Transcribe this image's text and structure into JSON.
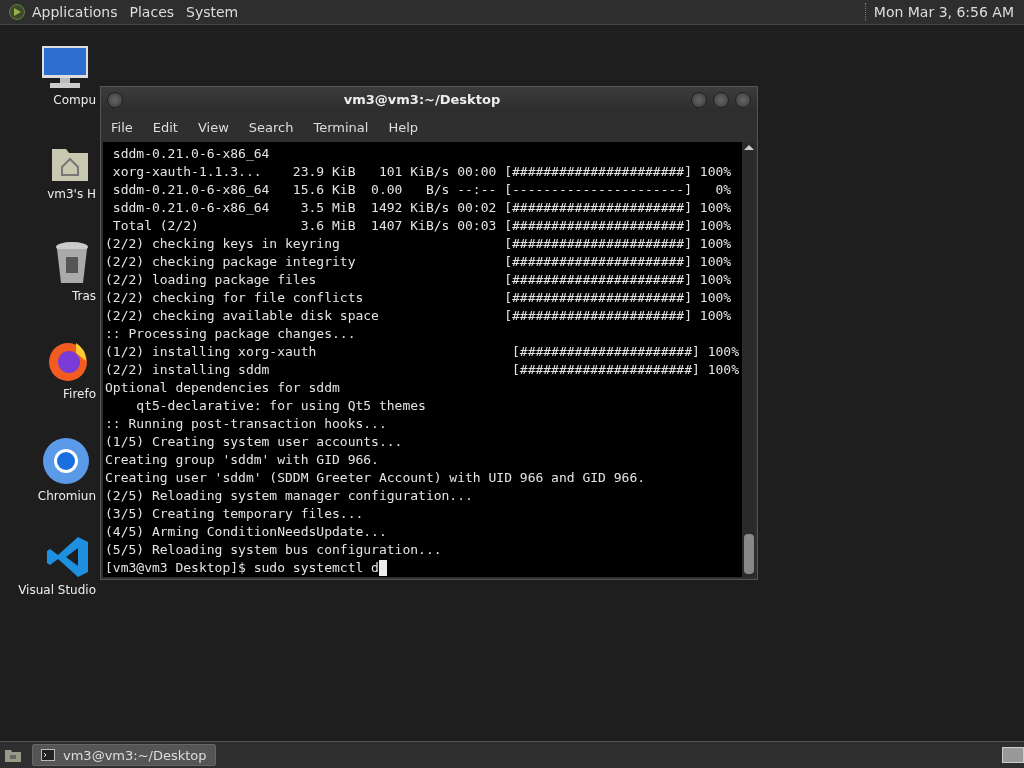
{
  "top_panel": {
    "menus": [
      "Applications",
      "Places",
      "System"
    ],
    "clock": "Mon Mar 3, 6:56 AM"
  },
  "desktop_icons": [
    {
      "kind": "computer",
      "label": "Compu"
    },
    {
      "kind": "home",
      "label": "vm3's H"
    },
    {
      "kind": "trash",
      "label": "Tras"
    },
    {
      "kind": "firefox",
      "label": "Firefo"
    },
    {
      "kind": "chromium",
      "label": "Chromiun"
    },
    {
      "kind": "vscode",
      "label": "Visual Studio"
    }
  ],
  "window": {
    "title": "vm3@vm3:~/Desktop",
    "menu": [
      "File",
      "Edit",
      "View",
      "Search",
      "Terminal",
      "Help"
    ],
    "lines": [
      {
        "kind": "output",
        "text": " sddm-0.21.0-6-x86_64"
      },
      {
        "kind": "output",
        "text": " xorg-xauth-1.1.3...    23.9 KiB   101 KiB/s 00:00 [######################] 100%"
      },
      {
        "kind": "output",
        "text": " sddm-0.21.0-6-x86_64   15.6 KiB  0.00   B/s --:-- [----------------------]   0%"
      },
      {
        "kind": "output",
        "text": " sddm-0.21.0-6-x86_64    3.5 MiB  1492 KiB/s 00:02 [######################] 100%"
      },
      {
        "kind": "output",
        "text": " Total (2/2)             3.6 MiB  1407 KiB/s 00:03 [######################] 100%"
      },
      {
        "kind": "output",
        "text": "(2/2) checking keys in keyring                     [######################] 100%"
      },
      {
        "kind": "output",
        "text": "(2/2) checking package integrity                   [######################] 100%"
      },
      {
        "kind": "output",
        "text": "(2/2) loading package files                        [######################] 100%"
      },
      {
        "kind": "output",
        "text": "(2/2) checking for file conflicts                  [######################] 100%"
      },
      {
        "kind": "output",
        "text": "(2/2) checking available disk space                [######################] 100%"
      },
      {
        "kind": "output",
        "text": ":: Processing package changes..."
      },
      {
        "kind": "output",
        "text": "(1/2) installing xorg-xauth                         [######################] 100%"
      },
      {
        "kind": "output",
        "text": "(2/2) installing sddm                               [######################] 100%"
      },
      {
        "kind": "output",
        "text": "Optional dependencies for sddm"
      },
      {
        "kind": "output",
        "text": "    qt5-declarative: for using Qt5 themes"
      },
      {
        "kind": "output",
        "text": ":: Running post-transaction hooks..."
      },
      {
        "kind": "output",
        "text": "(1/5) Creating system user accounts..."
      },
      {
        "kind": "output",
        "text": "Creating group 'sddm' with GID 966."
      },
      {
        "kind": "output",
        "text": "Creating user 'sddm' (SDDM Greeter Account) with UID 966 and GID 966."
      },
      {
        "kind": "output",
        "text": "(2/5) Reloading system manager configuration..."
      },
      {
        "kind": "output",
        "text": "(3/5) Creating temporary files..."
      },
      {
        "kind": "output",
        "text": "(4/5) Arming ConditionNeedsUpdate..."
      },
      {
        "kind": "output",
        "text": "(5/5) Reloading system bus configuration..."
      },
      {
        "kind": "prompt",
        "text": "[vm3@vm3 Desktop]$ sudo systemctl d"
      }
    ]
  },
  "taskbar": {
    "tasks": [
      {
        "label": "vm3@vm3:~/Desktop",
        "selected": true
      }
    ]
  }
}
